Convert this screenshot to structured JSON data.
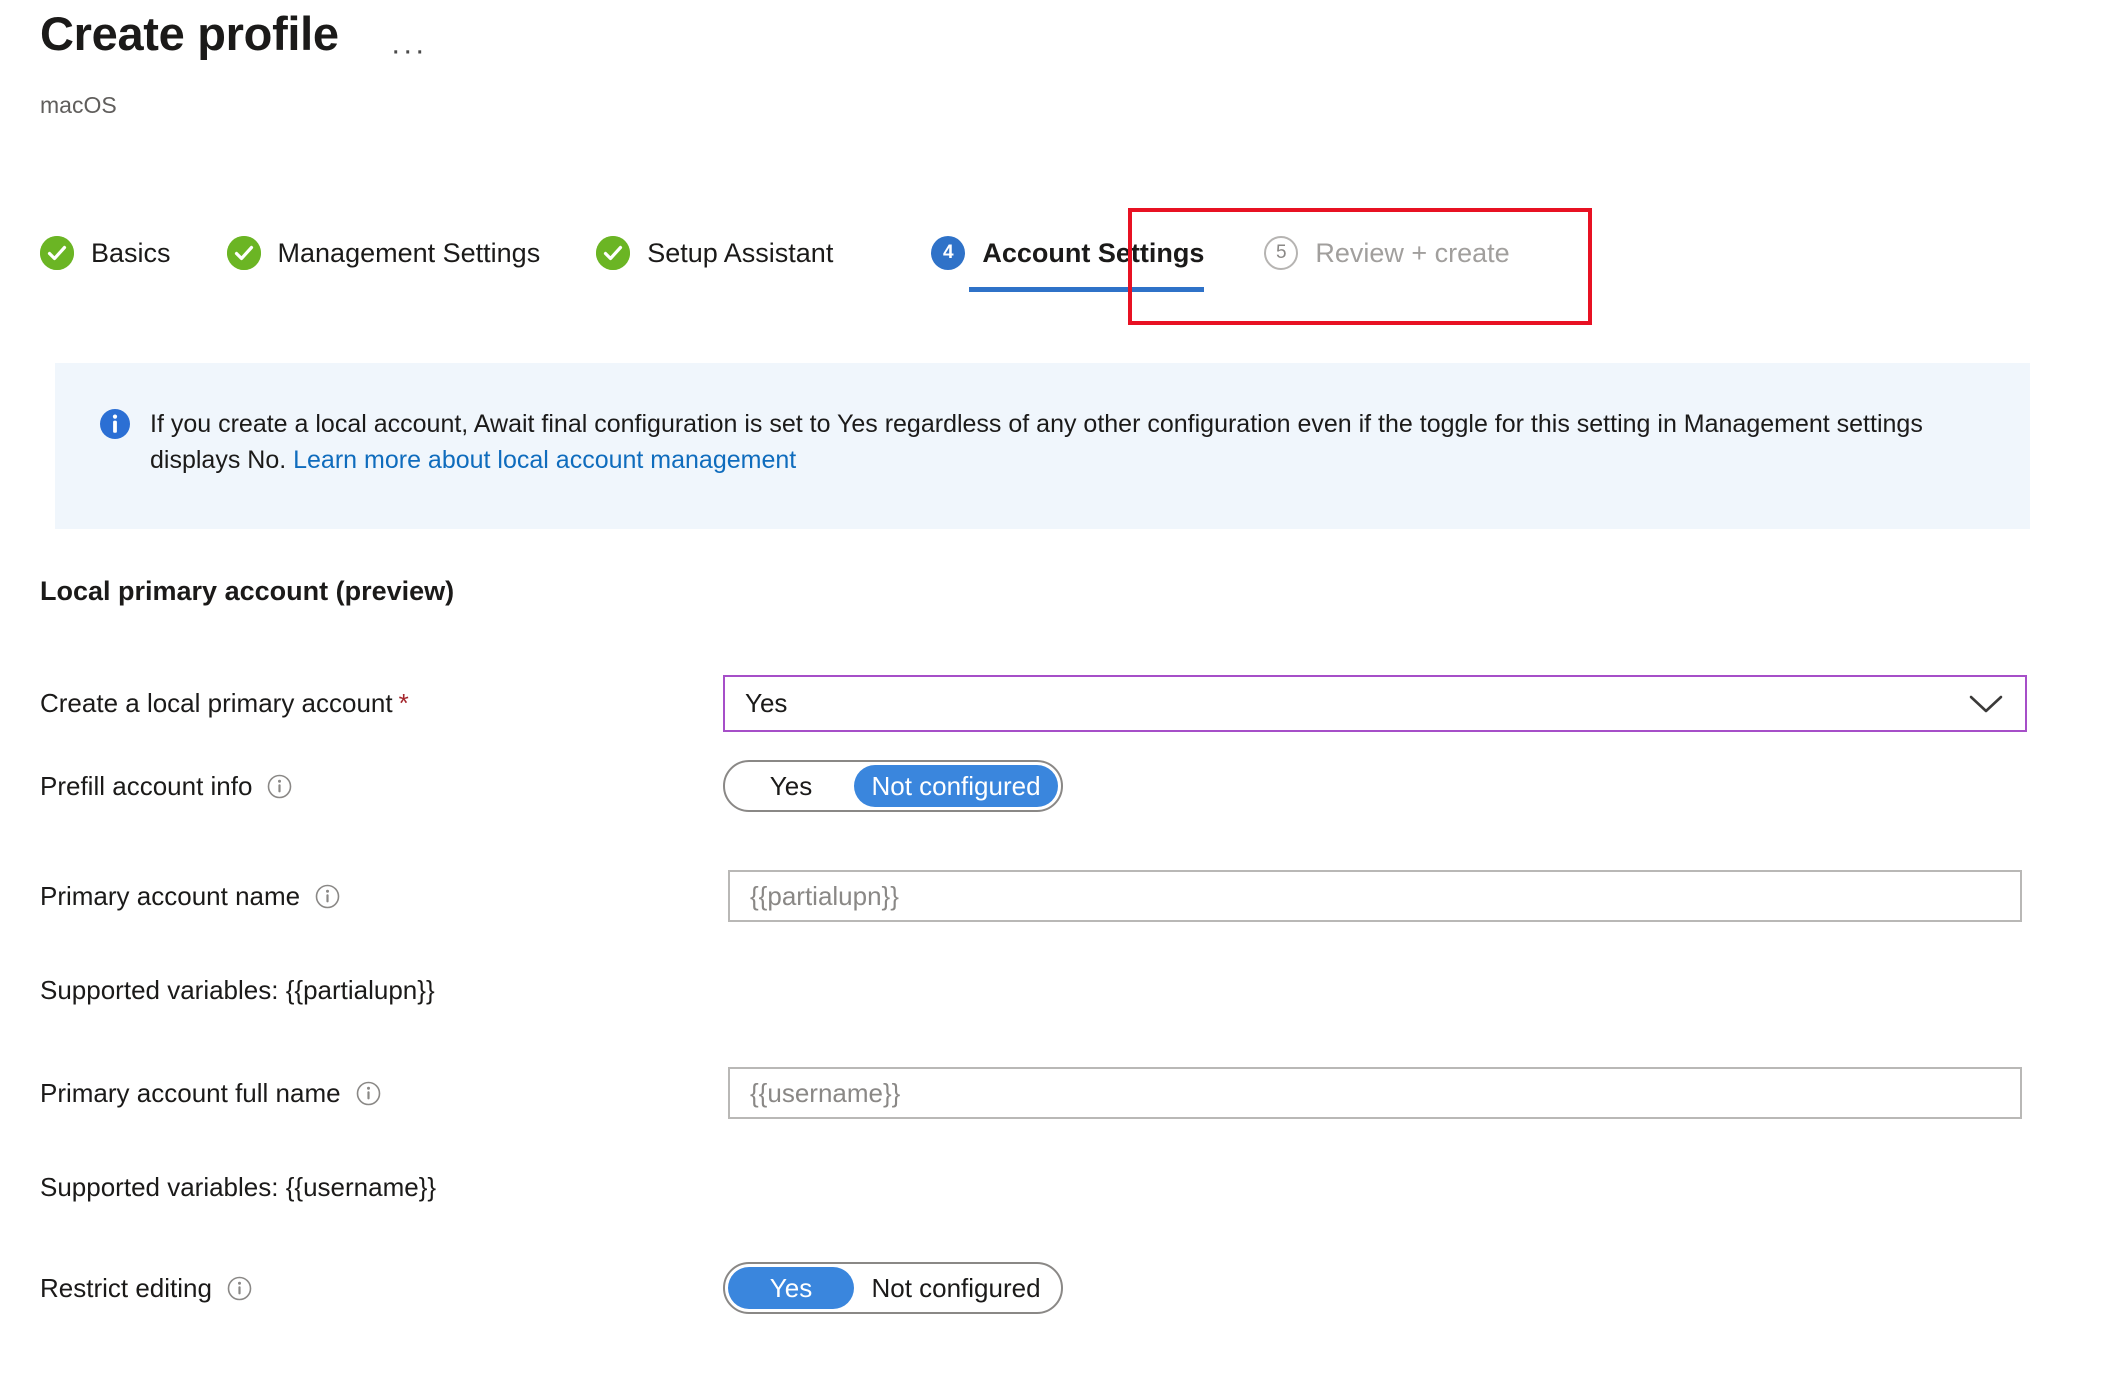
{
  "header": {
    "title": "Create profile",
    "subtitle": "macOS",
    "more_menu": "···"
  },
  "wizard": {
    "steps": [
      {
        "label": "Basics",
        "badge": "",
        "state": "done"
      },
      {
        "label": "Management Settings",
        "badge": "",
        "state": "done"
      },
      {
        "label": "Setup Assistant",
        "badge": "",
        "state": "done"
      },
      {
        "label": "Account Settings",
        "badge": "4",
        "state": "current"
      },
      {
        "label": "Review + create",
        "badge": "5",
        "state": "pending"
      }
    ],
    "highlight_color": "#e81123",
    "current_color": "#2f72c8",
    "done_color": "#6bb524"
  },
  "info_banner": {
    "text_before_link": "If you create a local account, Await final configuration is set to Yes regardless of any other configuration even if the toggle for this setting in Management settings displays No. ",
    "link_text": "Learn more about local account management",
    "background": "#f0f6fc",
    "accent": "#0f6cbd"
  },
  "form": {
    "section_heading": "Local primary account (preview)",
    "create_local_primary_account": {
      "label": "Create a local primary account",
      "required_marker": "*",
      "value": "Yes",
      "border_color": "#a64fc8"
    },
    "prefill_account_info": {
      "label": "Prefill account info",
      "options": [
        "Yes",
        "Not configured"
      ],
      "selected": "Not configured"
    },
    "primary_account_name": {
      "label": "Primary account name",
      "value": "{{partialupn}}",
      "placeholder": "{{partialupn}}",
      "helper": "Supported variables: {{partialupn}}"
    },
    "primary_account_full_name": {
      "label": "Primary account full name",
      "value": "{{username}}",
      "placeholder": "{{username}}",
      "helper": "Supported variables: {{username}}"
    },
    "restrict_editing": {
      "label": "Restrict editing",
      "options": [
        "Yes",
        "Not configured"
      ],
      "selected": "Yes"
    }
  }
}
